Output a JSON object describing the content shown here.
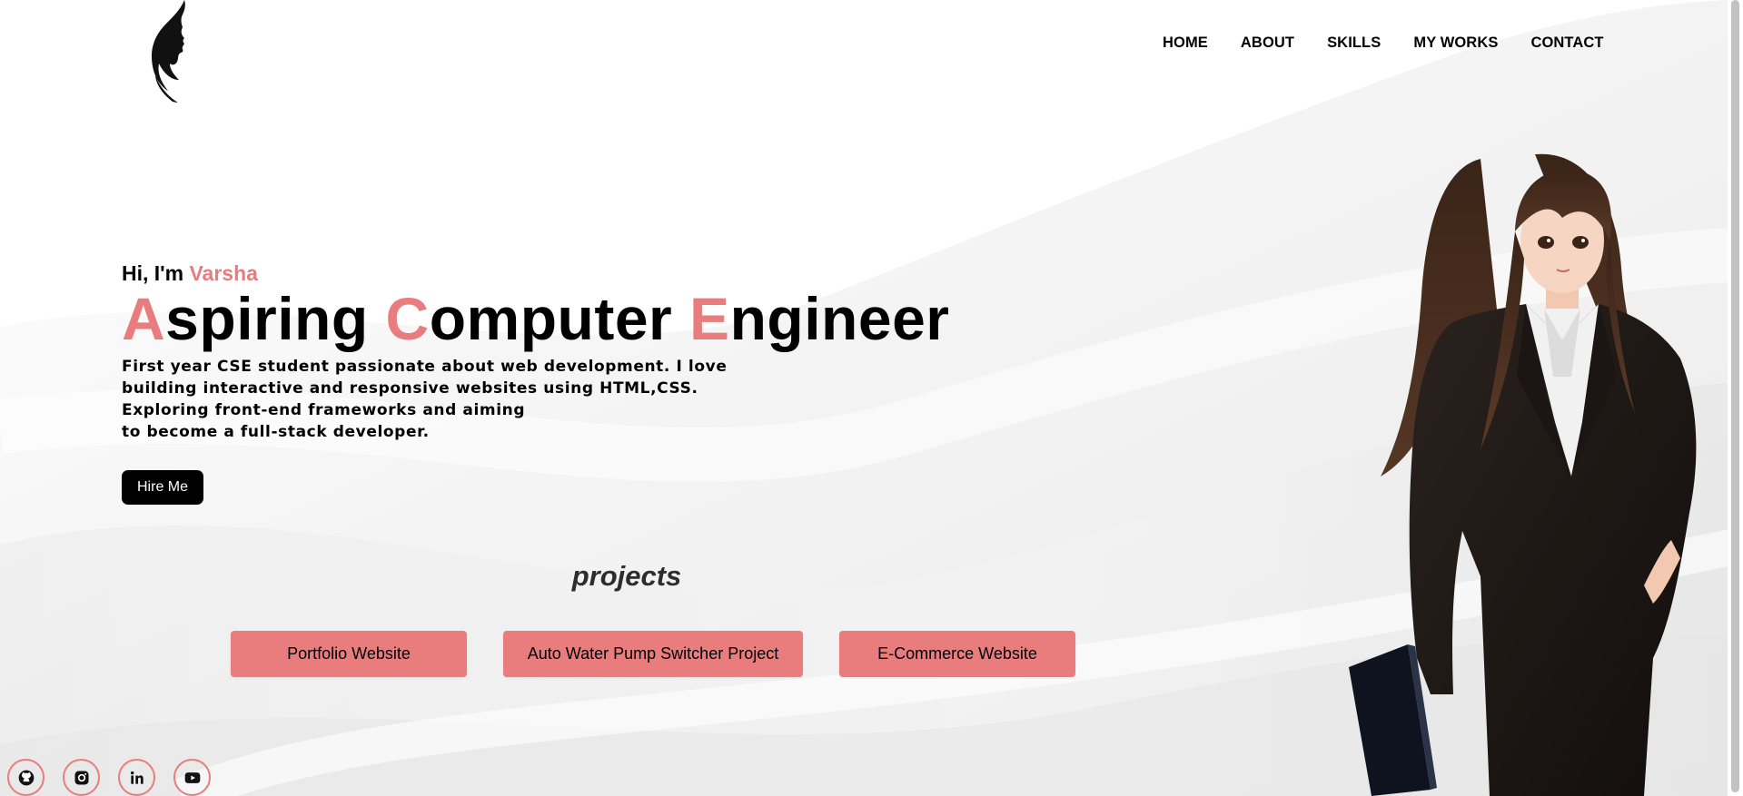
{
  "nav": {
    "items": [
      "HOME",
      "ABOUT",
      "SKILLS",
      "MY WORKS",
      "CONTACT"
    ]
  },
  "hero": {
    "greeting_prefix": "Hi, I'm ",
    "greeting_name": "Varsha",
    "headline": [
      {
        "first": "A",
        "rest": "spiring"
      },
      {
        "first": "C",
        "rest": "omputer"
      },
      {
        "first": "E",
        "rest": "ngineer"
      }
    ],
    "description_lines": [
      "First year CSE student passionate about web development. I love",
      "building interactive and responsive websites using HTML,CSS.",
      "Exploring front-end frameworks and aiming",
      "to become a full-stack developer."
    ],
    "cta_label": "Hire Me"
  },
  "projects": {
    "title": "projects",
    "items": [
      "Portfolio Website",
      "Auto Water Pump Switcher Project",
      "E-Commerce Website"
    ]
  },
  "socials": [
    "github-icon",
    "instagram-icon",
    "linkedin-icon",
    "youtube-icon"
  ],
  "colors": {
    "accent": "#e97c7c",
    "text": "#000000",
    "button_dark": "#000000",
    "background": "#ffffff"
  }
}
